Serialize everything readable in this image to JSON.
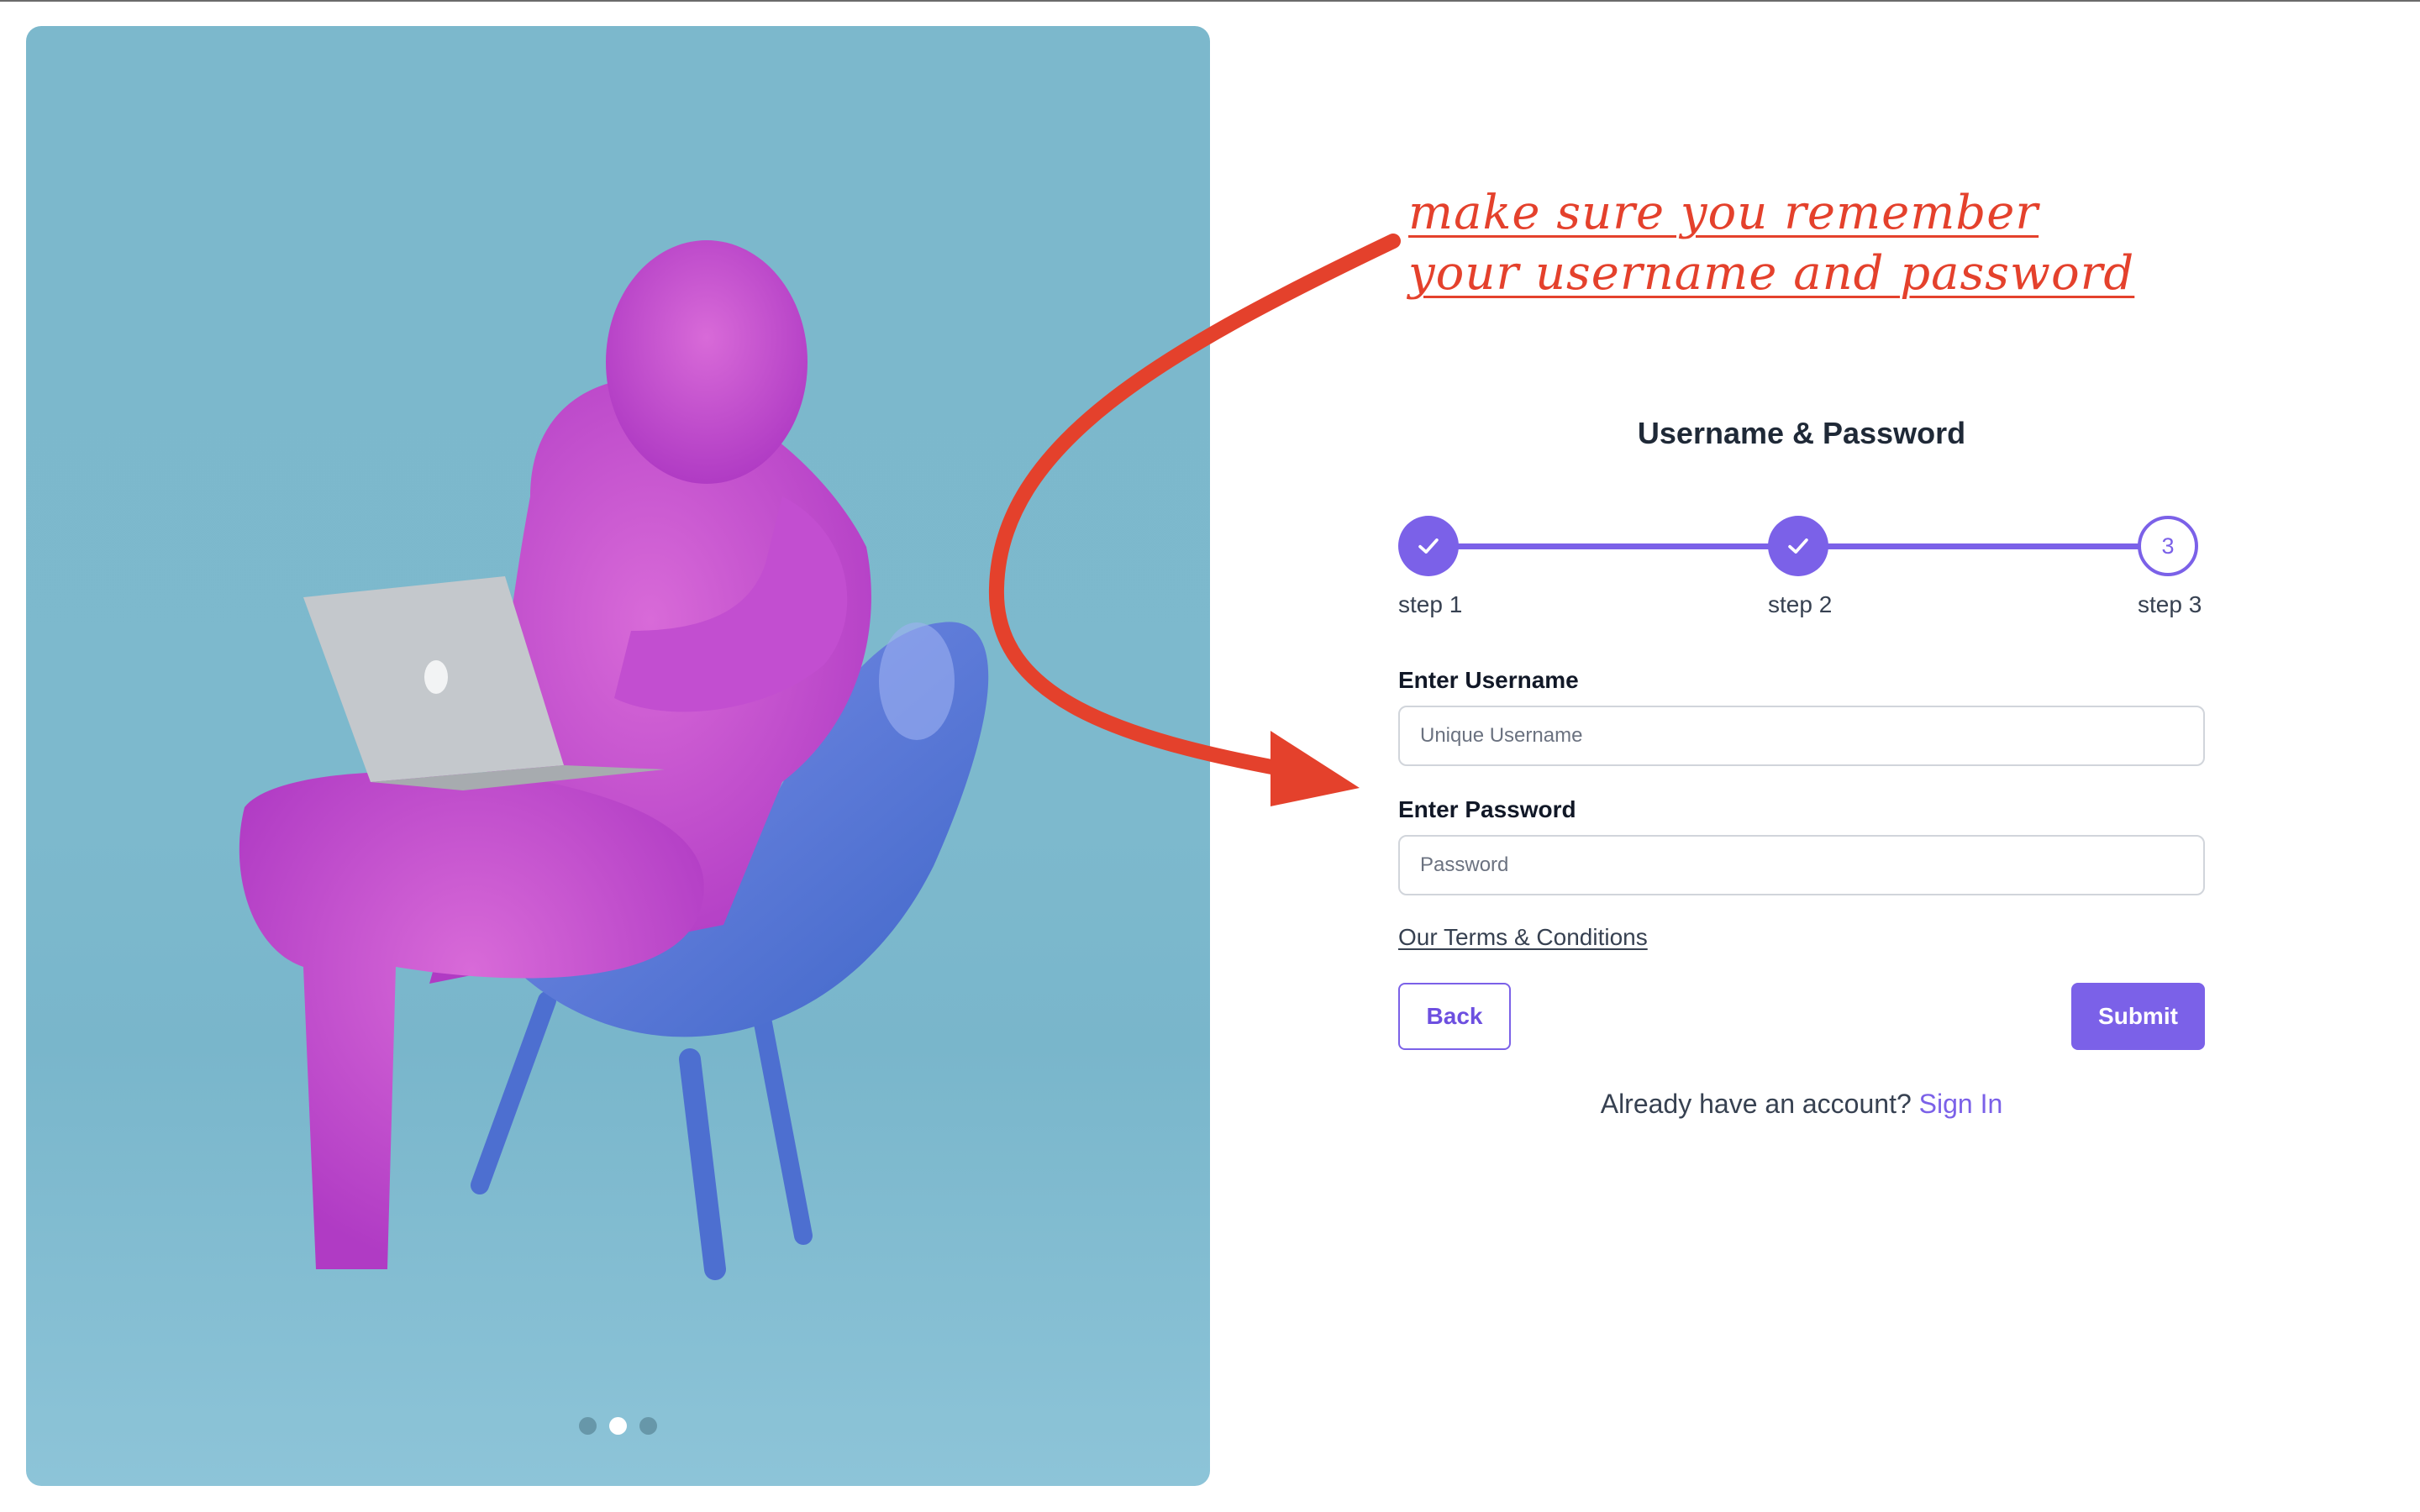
{
  "annotation": {
    "text": "make sure you remember your username and password",
    "color": "#e4412c"
  },
  "form": {
    "title": "Username & Password",
    "steps": [
      {
        "label": "step 1",
        "state": "complete",
        "icon": "check-icon"
      },
      {
        "label": "step 2",
        "state": "complete",
        "icon": "check-icon"
      },
      {
        "label": "step 3",
        "state": "current",
        "number": "3"
      }
    ],
    "username": {
      "label": "Enter Username",
      "placeholder": "Unique Username",
      "value": ""
    },
    "password": {
      "label": "Enter Password",
      "placeholder": "Password",
      "value": ""
    },
    "terms_link": "Our Terms & Conditions",
    "back_label": "Back",
    "submit_label": "Submit",
    "signin_prompt": "Already have an account?",
    "signin_link": "Sign In"
  },
  "carousel": {
    "slide_count": 3,
    "active_index": 1
  },
  "colors": {
    "accent": "#7b61e8",
    "hero_background": "#7cb8cc",
    "annotation": "#e4412c"
  }
}
